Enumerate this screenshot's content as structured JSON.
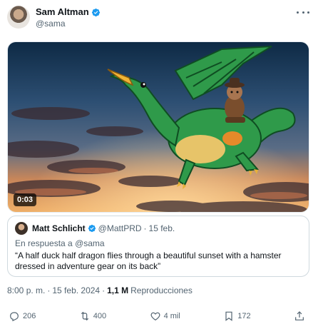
{
  "author": {
    "name": "Sam Altman",
    "handle": "@sama",
    "avatar": "avatar-icon"
  },
  "media": {
    "type": "video",
    "duration": "0:03",
    "description_icon": "video-thumbnail"
  },
  "quote": {
    "name": "Matt Schlicht",
    "handle": "@MattPRD",
    "date": "15 feb.",
    "reply_prefix": "En respuesta a ",
    "reply_to": "@sama",
    "text": "“A half duck half dragon flies through a beautiful sunset with a hamster dressed in adventure gear on its back”"
  },
  "meta": {
    "time": "8:00 p. m.",
    "date": "15 feb. 2024",
    "views": "1,1 M",
    "views_label": "Reproducciones"
  },
  "actions": {
    "replies": "206",
    "reposts": "400",
    "likes": "4 mil",
    "bookmarks": "172"
  },
  "colors": {
    "verified": "#1d9bf0",
    "text_secondary": "#536471",
    "text_primary": "#0f1419",
    "border": "#cfd9de"
  }
}
